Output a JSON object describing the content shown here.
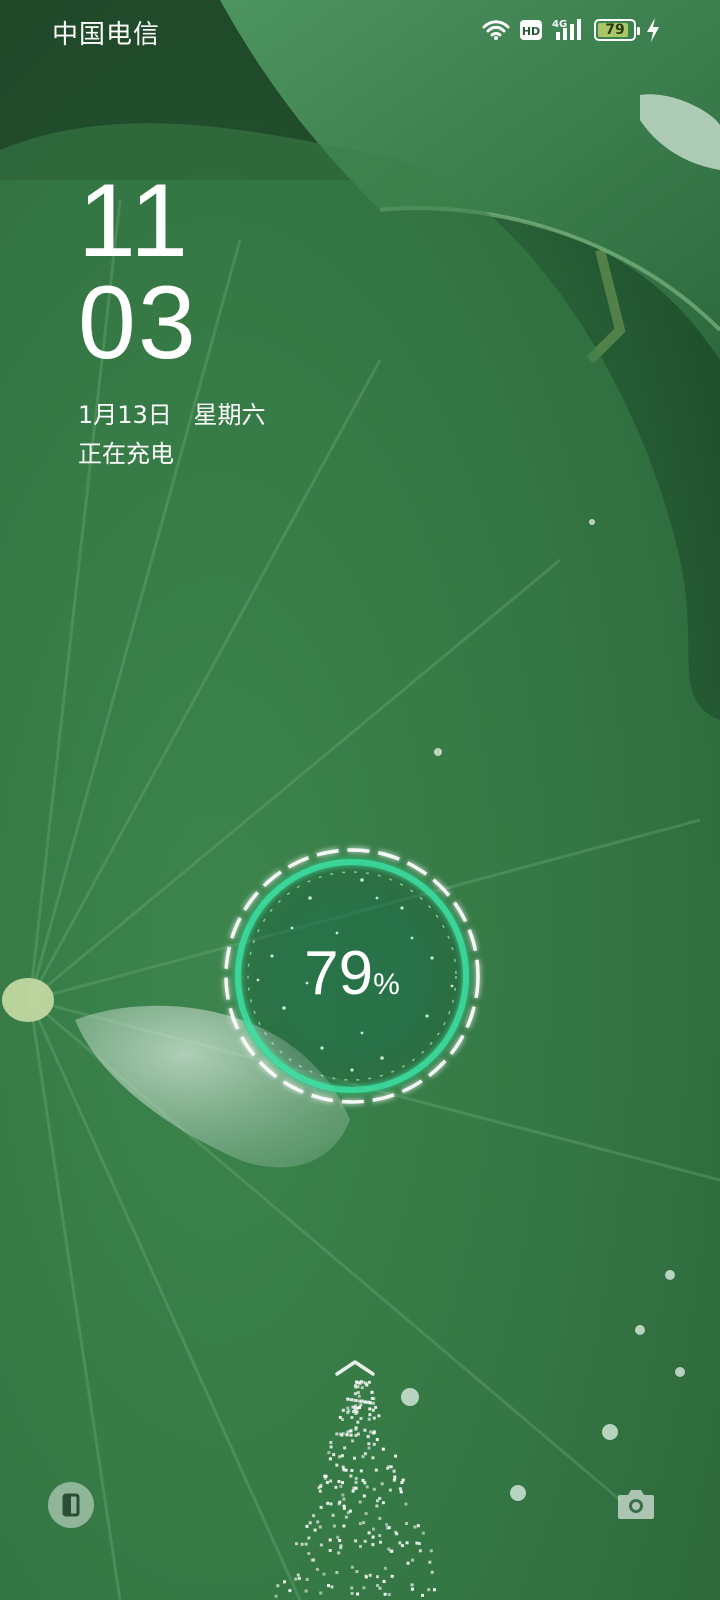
{
  "status_bar": {
    "carrier": "中国电信",
    "icons": [
      "wifi-icon",
      "hd-icon",
      "4g-signal-icon",
      "battery-icon",
      "charging-bolt-icon"
    ],
    "hd_label": "HD",
    "network_label": "4G",
    "battery_level": "79"
  },
  "lockscreen": {
    "hour": "11",
    "minute": "03",
    "date": "1月13日",
    "weekday": "星期六",
    "charging_status": "正在充电"
  },
  "charging_ring": {
    "percent": "79",
    "unit": "%",
    "accent_color": "#3ee6a8"
  },
  "bottom": {
    "left_icon": "wallet-card-icon",
    "right_icon": "camera-icon",
    "swipe_icon": "chevron-up-icon"
  }
}
